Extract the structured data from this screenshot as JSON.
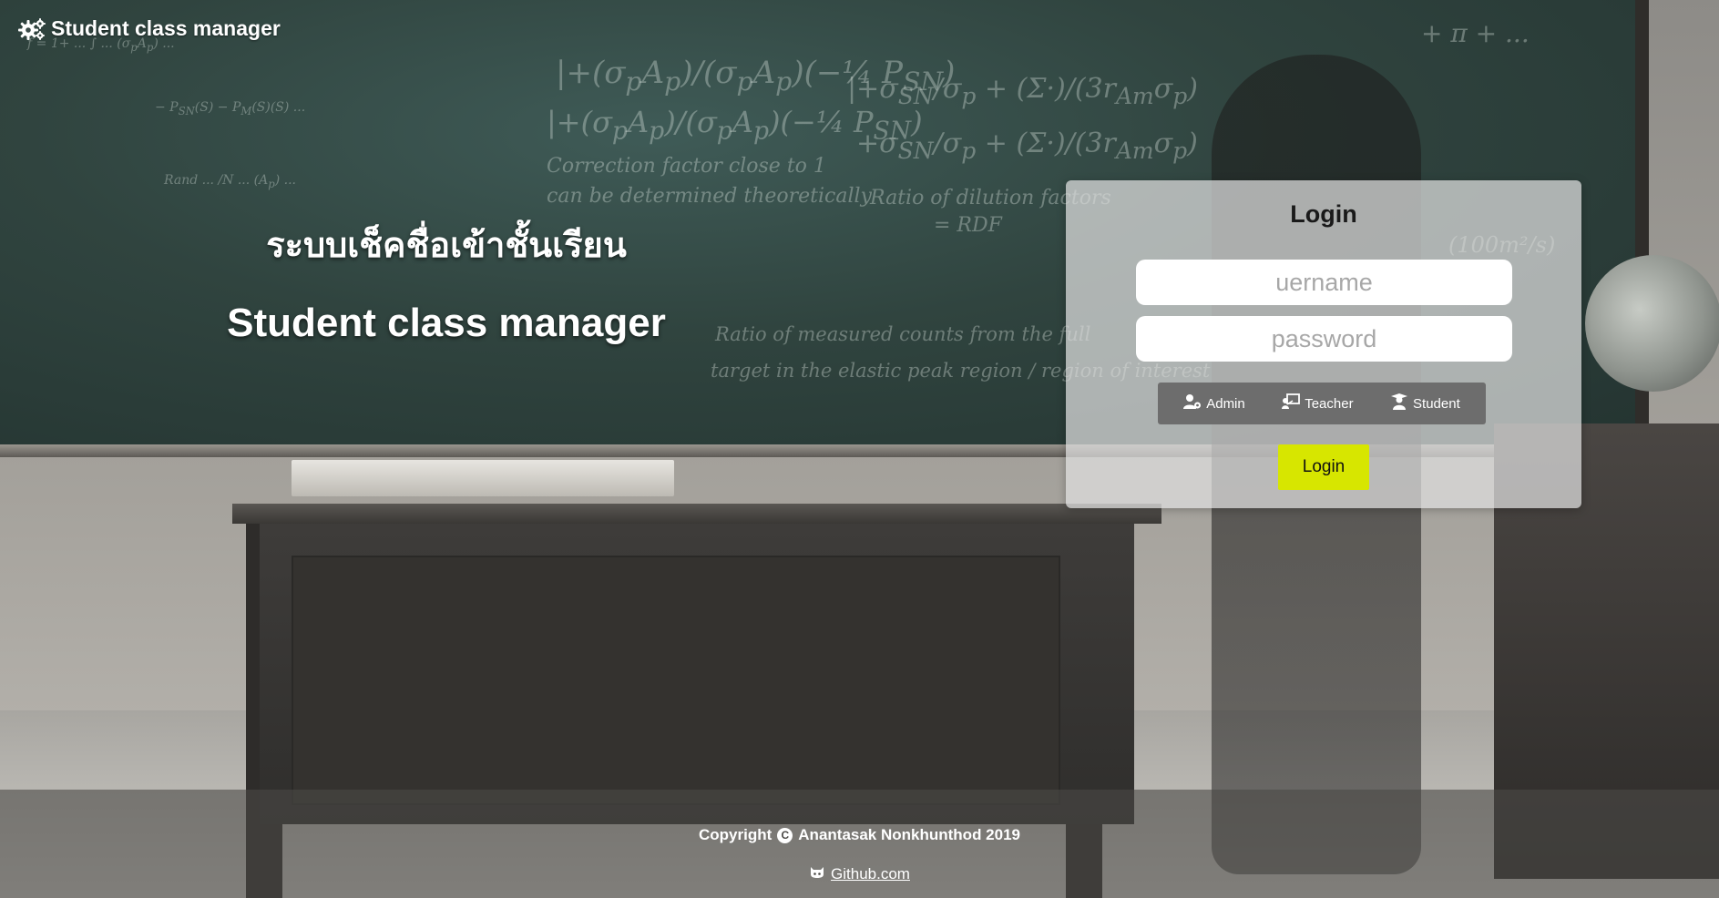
{
  "brand": {
    "icon": "gears-icon",
    "title": "Student class manager"
  },
  "hero": {
    "thai_title": "ระบบเช็คชื่อเข้าชั้นเรียน",
    "english_title": "Student class manager"
  },
  "login": {
    "title": "Login",
    "username_placeholder": "uername",
    "password_placeholder": "password",
    "roles": [
      {
        "icon": "user-cog-icon",
        "label": "Admin"
      },
      {
        "icon": "chalkboard-teacher-icon",
        "label": "Teacher"
      },
      {
        "icon": "user-graduate-icon",
        "label": "Student"
      }
    ],
    "submit_label": "Login",
    "accent_color": "#d7e600"
  },
  "footer": {
    "copyright_label": "Copyright",
    "copyright_icon": "copyright-icon",
    "owner": "Anantasak Nonkhunthod 2019",
    "github_icon": "github-icon",
    "github_label": "Github.com"
  }
}
